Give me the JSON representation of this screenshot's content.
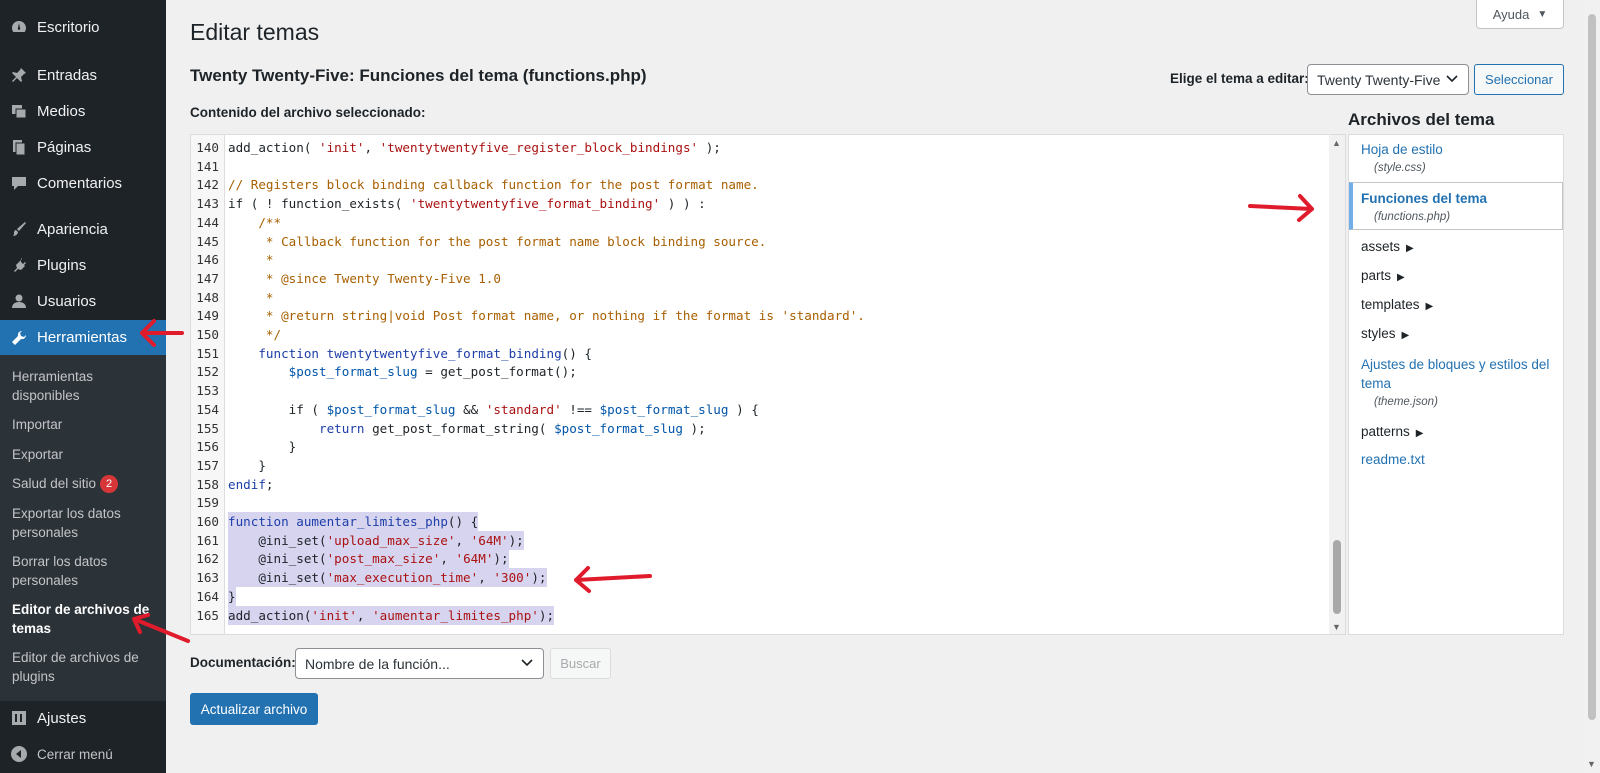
{
  "sidebar": {
    "items": [
      {
        "label": "Escritorio",
        "icon": "dashboard-icon"
      },
      {
        "label": "Entradas",
        "icon": "pin-icon"
      },
      {
        "label": "Medios",
        "icon": "media-icon"
      },
      {
        "label": "Páginas",
        "icon": "pages-icon"
      },
      {
        "label": "Comentarios",
        "icon": "comments-icon"
      },
      {
        "label": "Apariencia",
        "icon": "brush-icon"
      },
      {
        "label": "Plugins",
        "icon": "plugins-icon"
      },
      {
        "label": "Usuarios",
        "icon": "users-icon"
      },
      {
        "label": "Herramientas",
        "icon": "wrench-icon"
      },
      {
        "label": "Ajustes",
        "icon": "settings-icon"
      },
      {
        "label": "Cerrar menú",
        "icon": "collapse-icon"
      }
    ],
    "submenu": [
      {
        "label": "Herramientas disponibles"
      },
      {
        "label": "Importar"
      },
      {
        "label": "Exportar"
      },
      {
        "label": "Salud del sitio",
        "badge": "2"
      },
      {
        "label": "Exportar los datos personales"
      },
      {
        "label": "Borrar los datos personales"
      },
      {
        "label": "Editor de archivos de temas"
      },
      {
        "label": "Editor de archivos de plugins"
      }
    ]
  },
  "header": {
    "title": "Editar temas",
    "help_label": "Ayuda",
    "file_heading": "Twenty Twenty-Five: Funciones del tema (functions.php)",
    "theme_select_label": "Elige el tema a editar:",
    "theme_select_value": "Twenty Twenty-Five",
    "select_button": "Seleccionar",
    "content_label": "Contenido del archivo seleccionado:"
  },
  "editor": {
    "lines": [
      {
        "n": "140",
        "code": "add_action( 'init', 'twentytwentyfive_register_block_bindings' );"
      },
      {
        "n": "141",
        "code": ""
      },
      {
        "n": "142",
        "code": "// Registers block binding callback function for the post format name."
      },
      {
        "n": "143",
        "code": "if ( ! function_exists( 'twentytwentyfive_format_binding' ) ) :"
      },
      {
        "n": "144",
        "code": "    /**"
      },
      {
        "n": "145",
        "code": "     * Callback function for the post format name block binding source."
      },
      {
        "n": "146",
        "code": "     *"
      },
      {
        "n": "147",
        "code": "     * @since Twenty Twenty-Five 1.0"
      },
      {
        "n": "148",
        "code": "     *"
      },
      {
        "n": "149",
        "code": "     * @return string|void Post format name, or nothing if the format is 'standard'."
      },
      {
        "n": "150",
        "code": "     */"
      },
      {
        "n": "151",
        "code": "    function twentytwentyfive_format_binding() {"
      },
      {
        "n": "152",
        "code": "        $post_format_slug = get_post_format();"
      },
      {
        "n": "153",
        "code": ""
      },
      {
        "n": "154",
        "code": "        if ( $post_format_slug && 'standard' !== $post_format_slug ) {"
      },
      {
        "n": "155",
        "code": "            return get_post_format_string( $post_format_slug );"
      },
      {
        "n": "156",
        "code": "        }"
      },
      {
        "n": "157",
        "code": "    }"
      },
      {
        "n": "158",
        "code": "endif;"
      },
      {
        "n": "159",
        "code": ""
      },
      {
        "n": "160",
        "code": "function aumentar_limites_php() {"
      },
      {
        "n": "161",
        "code": "    @ini_set('upload_max_size', '64M');"
      },
      {
        "n": "162",
        "code": "    @ini_set('post_max_size', '64M');"
      },
      {
        "n": "163",
        "code": "    @ini_set('max_execution_time', '300');"
      },
      {
        "n": "164",
        "code": "}"
      },
      {
        "n": "165",
        "code": "add_action('init', 'aumentar_limites_php');"
      }
    ]
  },
  "files": {
    "title": "Archivos del tema",
    "stylesheet_label": "Hoja de estilo",
    "stylesheet_file": "(style.css)",
    "functions_label": "Funciones del tema",
    "functions_file": "(functions.php)",
    "folders": [
      "assets",
      "parts",
      "templates",
      "styles"
    ],
    "themejson_label": "Ajustes de bloques y estilos del tema",
    "themejson_file": "(theme.json)",
    "patterns_label": "patterns",
    "readme_label": "readme.txt"
  },
  "bottom": {
    "doc_label": "Documentación:",
    "doc_select_value": "Nombre de la función...",
    "lookup_button": "Buscar",
    "update_button": "Actualizar archivo"
  },
  "colors": {
    "sidebar_bg": "#1d2327",
    "accent": "#2271b1",
    "annotation": "#e01b2c",
    "highlight": "#d7d4f0"
  }
}
